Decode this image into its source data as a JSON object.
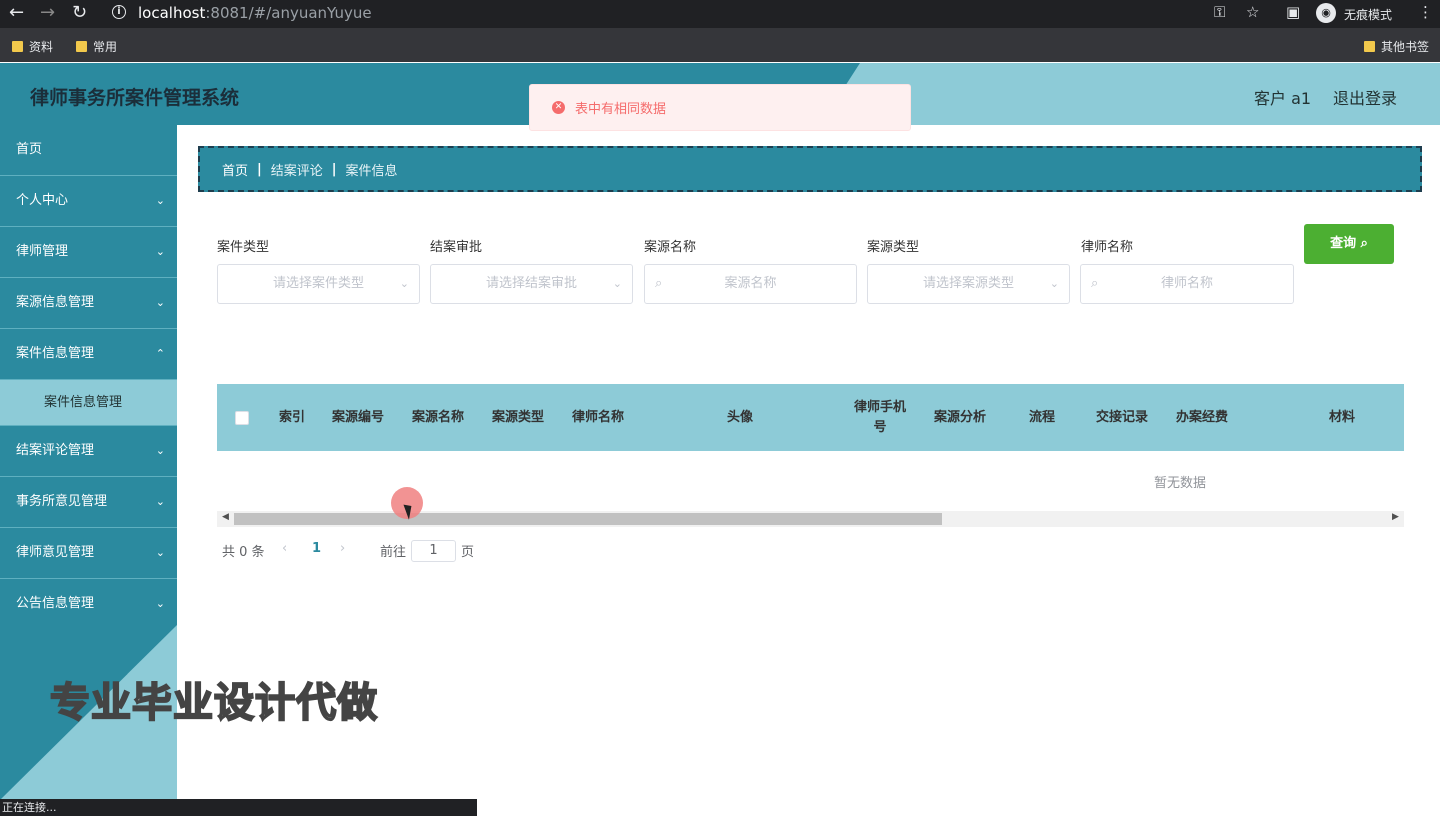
{
  "browser": {
    "url_host": "localhost",
    "url_path": ":8081/#/anyuanYuyue",
    "incognito_label": "无痕模式",
    "bookmarks": [
      "资料",
      "常用"
    ],
    "other_bookmarks": "其他书签",
    "status_text": "正在连接..."
  },
  "header": {
    "title": "律师事务所案件管理系统",
    "user": "客户 a1",
    "logout": "退出登录"
  },
  "toast": {
    "message": "表中有相同数据"
  },
  "sidebar": {
    "items": [
      "首页",
      "个人中心",
      "律师管理",
      "案源信息管理",
      "案件信息管理"
    ],
    "sub_item": "案件信息管理",
    "items2": [
      "结案评论管理",
      "事务所意见管理",
      "律师意见管理",
      "公告信息管理"
    ]
  },
  "watermark": "专业毕业设计代做",
  "breadcrumb": [
    "首页",
    "结案评论",
    "案件信息"
  ],
  "filters": {
    "labels": [
      "案件类型",
      "结案审批",
      "案源名称",
      "案源类型",
      "律师名称"
    ],
    "placeholders": [
      "请选择案件类型",
      "请选择结案审批",
      "案源名称",
      "请选择案源类型",
      "律师名称"
    ],
    "query_button": "查询"
  },
  "table": {
    "columns": [
      "索引",
      "案源编号",
      "案源名称",
      "案源类型",
      "律师名称",
      "头像",
      "律师手机号",
      "案源分析",
      "流程",
      "交接记录",
      "办案经费",
      "材料"
    ],
    "empty_text": "暂无数据"
  },
  "pagination": {
    "total_text": "共 0 条",
    "current_page": "1",
    "goto_label": "前往",
    "goto_value": "1",
    "page_suffix": "页"
  },
  "colors": {
    "primary": "#2b8a9f",
    "accent": "#8dcbd7",
    "query": "#4caf32",
    "error": "#f56c6c"
  }
}
